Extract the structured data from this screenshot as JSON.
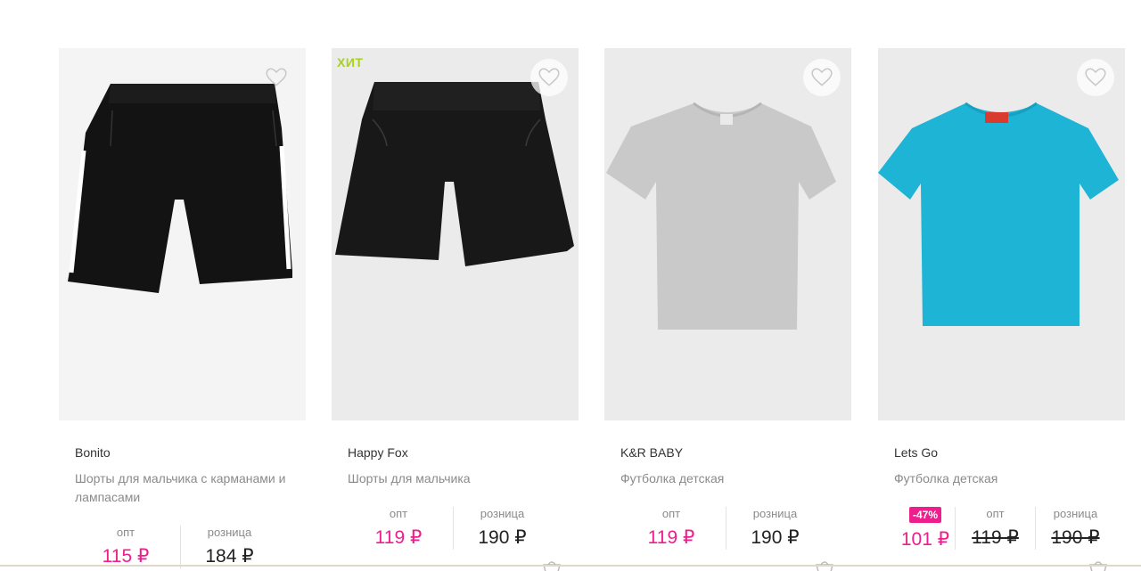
{
  "products": [
    {
      "brand": "Bonito",
      "title": "Шорты для мальчика с карманами и лампасами",
      "badge": "",
      "opt_label": "опт",
      "opt_price": "115 ₽",
      "retail_label": "розница",
      "retail_price": "184 ₽"
    },
    {
      "brand": "Happy Fox",
      "title": "Шорты для мальчика",
      "badge": "ХИТ",
      "opt_label": "опт",
      "opt_price": "119 ₽",
      "retail_label": "розница",
      "retail_price": "190 ₽"
    },
    {
      "brand": "K&R BABY",
      "title": "Футболка детская",
      "badge": "",
      "opt_label": "опт",
      "opt_price": "119 ₽",
      "retail_label": "розница",
      "retail_price": "190 ₽"
    },
    {
      "brand": "Lets Go",
      "title": "Футболка детская",
      "badge": "",
      "discount": "-47%",
      "discounted_price": "101 ₽",
      "opt_label": "опт",
      "opt_price": "119 ₽",
      "retail_label": "розница",
      "retail_price": "190 ₽"
    }
  ],
  "icons": {
    "favorite": "heart-outline-icon",
    "cart": "cart-icon"
  },
  "colors": {
    "accent_pink": "#ee1e8e",
    "hit_green": "#a8d11f",
    "photo_bg": "#ebebeb",
    "tshirt_gray": "#c9c9c9",
    "tshirt_blue": "#1db4d6",
    "shorts_black": "#141414"
  }
}
